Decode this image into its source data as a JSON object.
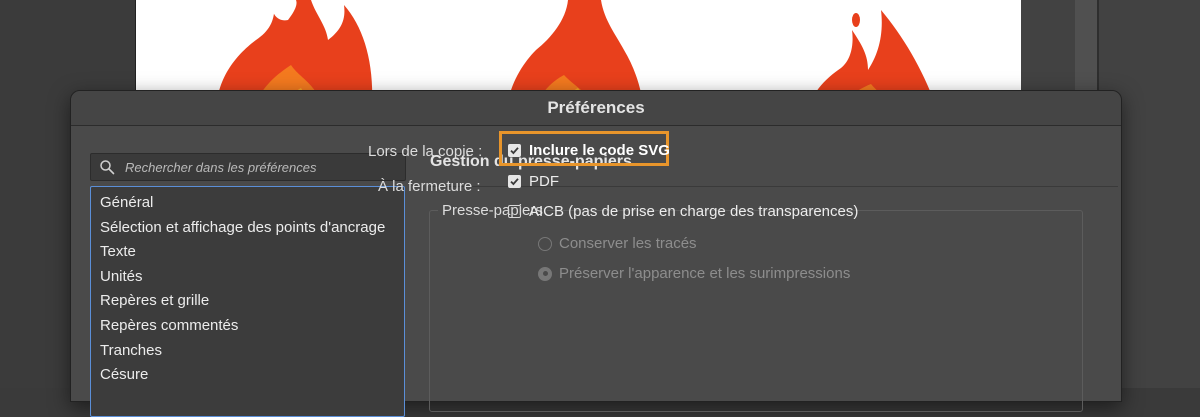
{
  "dialog": {
    "title": "Préférences"
  },
  "search": {
    "placeholder": "Rechercher dans les préférences",
    "value": ""
  },
  "categories": [
    "Général",
    "Sélection et affichage des points d'ancrage",
    "Texte",
    "Unités",
    "Repères et grille",
    "Repères commentés",
    "Tranches",
    "Césure"
  ],
  "panel": {
    "title": "Gestion du presse-papiers",
    "group_title": "Presse-papiers",
    "copy_label": "Lors de la copie :",
    "close_label": "À la fermeture :",
    "options": {
      "svg_label": "Inclure le code SVG",
      "svg_checked": true,
      "pdf_label": "PDF",
      "pdf_checked": true,
      "aicb_label": "AICB (pas de prise en charge des transparences)",
      "aicb_checked": false
    },
    "radios": {
      "preserve_paths_label": "Conserver les tracés",
      "preserve_appearance_label": "Préserver l'apparence et les surimpressions",
      "selected": "preserve_appearance",
      "enabled": false
    }
  },
  "colors": {
    "highlight": "#e8952b",
    "flame_outer": "#e8401c",
    "flame_inner": "#f47a1f",
    "flame_core": "#f9a825"
  }
}
